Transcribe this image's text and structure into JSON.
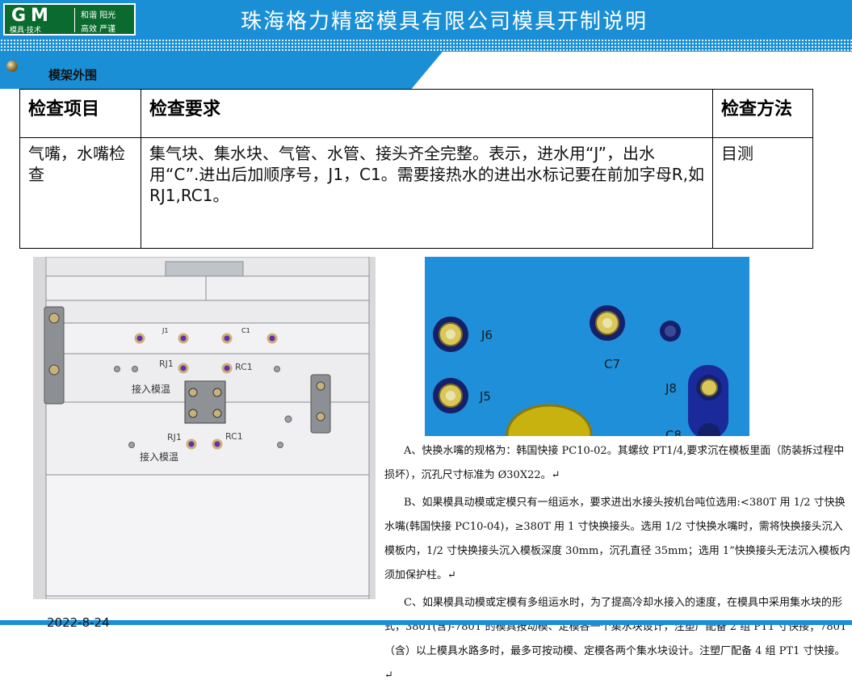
{
  "header": {
    "logo_gm": "GM",
    "logo_sub": "模具·技术",
    "logo_motto_line1": "和谐  阳光",
    "logo_motto_line2": "高效  严谨",
    "title": "珠海格力精密模具有限公司模具开制说明"
  },
  "section": {
    "title": "模架外围"
  },
  "table": {
    "headers": [
      "检查项目",
      "检查要求",
      "检查方法"
    ],
    "row": {
      "item": "气嘴，水嘴检查",
      "requirement": "集气块、集水块、气管、水管、接头齐全完整。表示，进水用“J”，出水用“C”.进出后加顺序号，J1，C1。需要接热水的进出水标记要在前加字母R,如RJ1,RC1。",
      "method": "目测"
    }
  },
  "mold_drawing": {
    "labels": [
      "J1",
      "C1",
      "RJ1",
      "RC1",
      "接入模温",
      "RJ1",
      "RC1",
      "接入模温"
    ]
  },
  "plate_photo": {
    "labels": [
      "J6",
      "C7",
      "J5",
      "J8",
      "C8"
    ]
  },
  "notes": {
    "a": "A、快换水嘴的规格为：韩国快接 PC10-02。其螺纹 PT1/4,要求沉在模板里面（防装拆过程中损坏），沉孔尺寸标准为 Ø30X22。↵",
    "b": "B、如果模具动模或定模只有一组运水，要求进出水接头按机台吨位选用:<380T 用 1/2 寸快换水嘴(韩国快接 PC10-04)，≥380T 用 1 寸快换接头。选用 1/2 寸快换水嘴时，需将快换接头沉入模板内，1/2 寸快换接头沉入模板深度 30mm，沉孔直径 35mm；选用 1”快换接头无法沉入模板内须加保护柱。↵",
    "c": "C、如果模具动模或定模有多组运水时，为了提高冷却水接入的速度，在模具中采用集水块的形式，380T(含)-780T 的模具按动模、定模各一个集水块设计，注塑厂配备 2 组 PT1 寸快接；780T（含）以上模具水路多时，最多可按动模、定模各两个集水块设计。注塑厂配备 4 组 PT1 寸快接。↵"
  },
  "footer": {
    "date": "2022-8-24"
  },
  "colors": {
    "brand_blue": "#1a8fd6",
    "logo_green": "#0b6b2f",
    "plate_blue": "#1e8fd8"
  }
}
